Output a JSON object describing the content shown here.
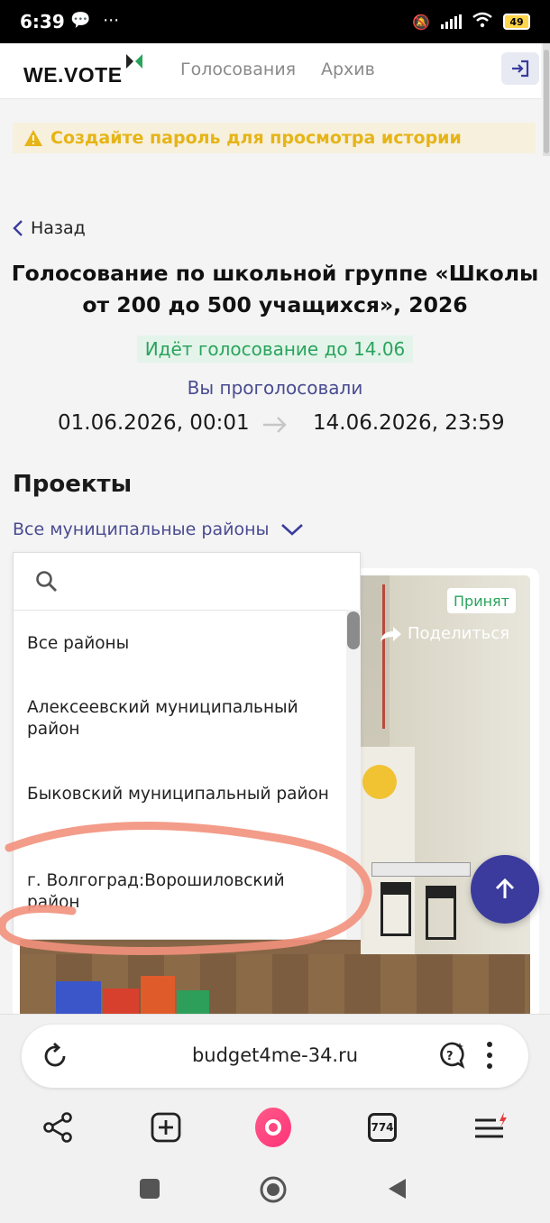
{
  "status_bar": {
    "time": "6:39",
    "left_icons": "💬 ⋯",
    "battery": "49"
  },
  "header": {
    "logo": "WE.VOTE",
    "nav": [
      "Голосования",
      "Архив"
    ],
    "brand_color": "#2aa45d"
  },
  "banner": {
    "text": "Создайте пароль для просмотра истории",
    "color": "#e6b417"
  },
  "back_label": "Назад",
  "vote": {
    "title_line1": "Голосование по школьной группе «Школы",
    "title_line2": "от 200 до 500 учащихся», 2026",
    "status": "Идёт голосование до 14.06",
    "voted": "Вы проголосовали",
    "start": "01.06.2026, 00:01",
    "end": "14.06.2026, 23:59"
  },
  "projects": {
    "heading": "Проекты",
    "district_filter": "Все муниципальные районы",
    "card_badge": "Принят",
    "share_label": "Поделиться"
  },
  "dropdown": {
    "search_placeholder": "",
    "items": [
      "Все районы",
      "Алексеевский муниципальный район",
      "Быковский муниципальный район",
      "г. Волгоград:Ворошиловский район"
    ]
  },
  "browser": {
    "url": "budget4me-34.ru",
    "tabs_count": "774"
  }
}
